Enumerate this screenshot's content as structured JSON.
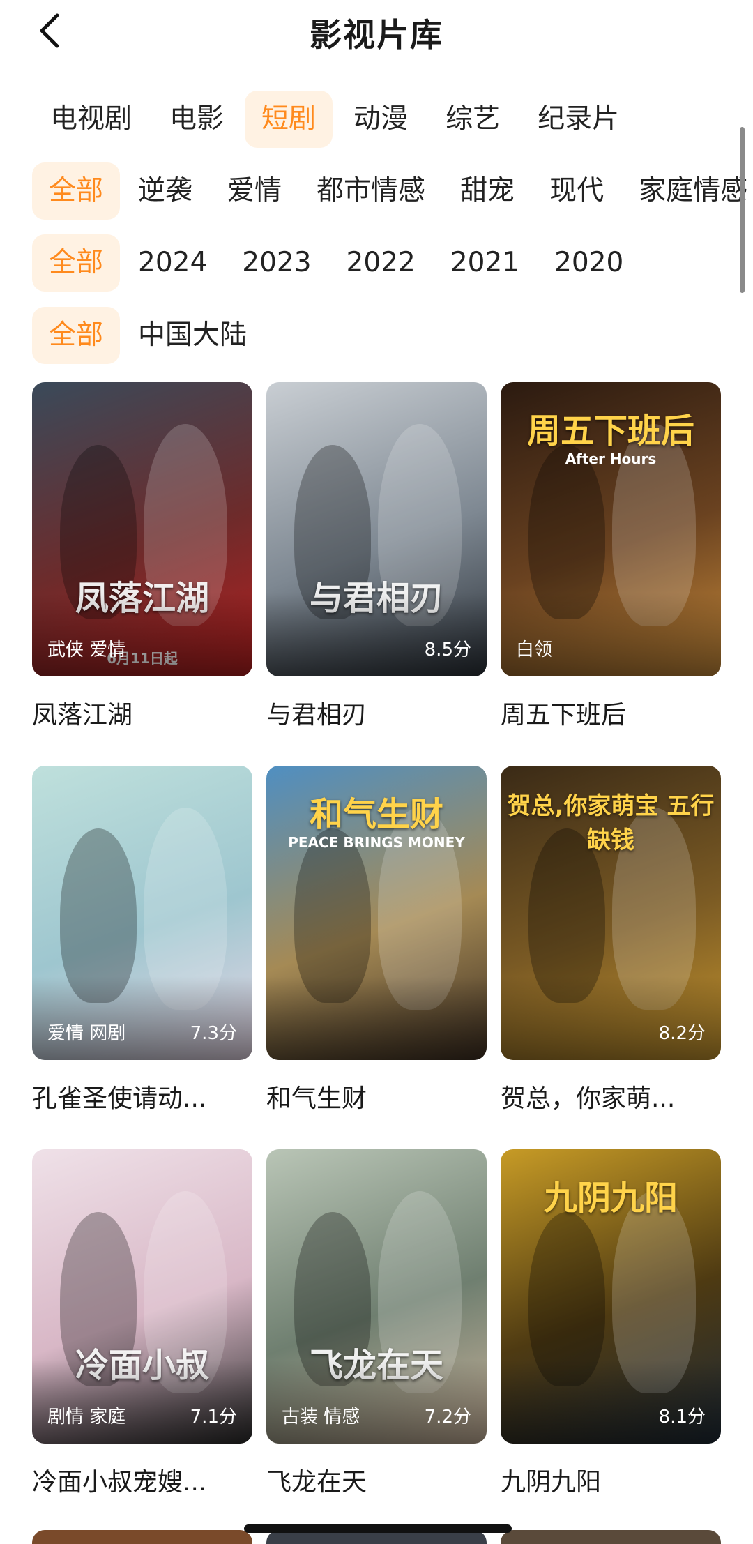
{
  "header": {
    "title": "影视片库",
    "back_icon": "chevron-left-icon"
  },
  "filters": {
    "types": [
      {
        "label": "电视剧",
        "active": false
      },
      {
        "label": "电影",
        "active": false
      },
      {
        "label": "短剧",
        "active": true
      },
      {
        "label": "动漫",
        "active": false
      },
      {
        "label": "综艺",
        "active": false
      },
      {
        "label": "纪录片",
        "active": false
      }
    ],
    "genres": [
      {
        "label": "全部",
        "active": true
      },
      {
        "label": "逆袭",
        "active": false
      },
      {
        "label": "爱情",
        "active": false
      },
      {
        "label": "都市情感",
        "active": false
      },
      {
        "label": "甜宠",
        "active": false
      },
      {
        "label": "现代",
        "active": false
      },
      {
        "label": "家庭情感",
        "active": false
      }
    ],
    "years": [
      {
        "label": "全部",
        "active": true
      },
      {
        "label": "2024",
        "active": false
      },
      {
        "label": "2023",
        "active": false
      },
      {
        "label": "2022",
        "active": false
      },
      {
        "label": "2021",
        "active": false
      },
      {
        "label": "2020",
        "active": false
      }
    ],
    "regions": [
      {
        "label": "全部",
        "active": true
      },
      {
        "label": "中国大陆",
        "active": false
      }
    ]
  },
  "colors": {
    "accent": "#FF8A1D",
    "accent_bg": "#FFF2E3"
  },
  "items": [
    {
      "title": "凤落江湖",
      "tags": "武侠 爱情",
      "score": "",
      "poster_text": "凤落江湖",
      "sub_text": "6月11日起",
      "palette": [
        "#3a4a5a",
        "#6d2b2b",
        "#b51f1f"
      ]
    },
    {
      "title": "与君相刃",
      "tags": "",
      "score": "8.5分",
      "poster_text": "与君相刃",
      "sub_text": "",
      "palette": [
        "#c9ced3",
        "#7e8892",
        "#2b3138"
      ]
    },
    {
      "title": "周五下班后",
      "tags": "白领",
      "score": "",
      "poster_text": "周五下班后",
      "sub_text": "After Hours",
      "palette": [
        "#2b1a10",
        "#6a4220",
        "#c78a3a"
      ]
    },
    {
      "title": "孔雀圣使请动...",
      "tags": "爱情 网剧",
      "score": "7.3分",
      "poster_text": "",
      "sub_text": "",
      "palette": [
        "#bfe0dc",
        "#9ec6cf",
        "#e7d7e6"
      ]
    },
    {
      "title": "和气生财",
      "tags": "",
      "score": "",
      "poster_text": "和气生财",
      "sub_text": "PEACE BRINGS MONEY",
      "palette": [
        "#4f8fc2",
        "#a58a55",
        "#3e2f22"
      ]
    },
    {
      "title": "贺总，你家萌...",
      "tags": "",
      "score": "8.2分",
      "poster_text": "贺总,你家萌宝 五行缺钱",
      "sub_text": "",
      "palette": [
        "#3a2a16",
        "#7a5a24",
        "#c4942e"
      ]
    },
    {
      "title": "冷面小叔宠嫂...",
      "tags": "剧情 家庭",
      "score": "7.1分",
      "poster_text": "冷面小叔",
      "sub_text": "",
      "palette": [
        "#efe1e8",
        "#d8b7c6",
        "#2c2c2c"
      ]
    },
    {
      "title": "飞龙在天",
      "tags": "古装 情感",
      "score": "7.2分",
      "poster_text": "飞龙在天",
      "sub_text": "",
      "palette": [
        "#b9c5b6",
        "#6f7f70",
        "#c9b39b"
      ]
    },
    {
      "title": "九阴九阳",
      "tags": "",
      "score": "8.1分",
      "poster_text": "九阴九阳",
      "sub_text": "",
      "palette": [
        "#c79b26",
        "#4e3a12",
        "#1e2a36"
      ]
    }
  ]
}
